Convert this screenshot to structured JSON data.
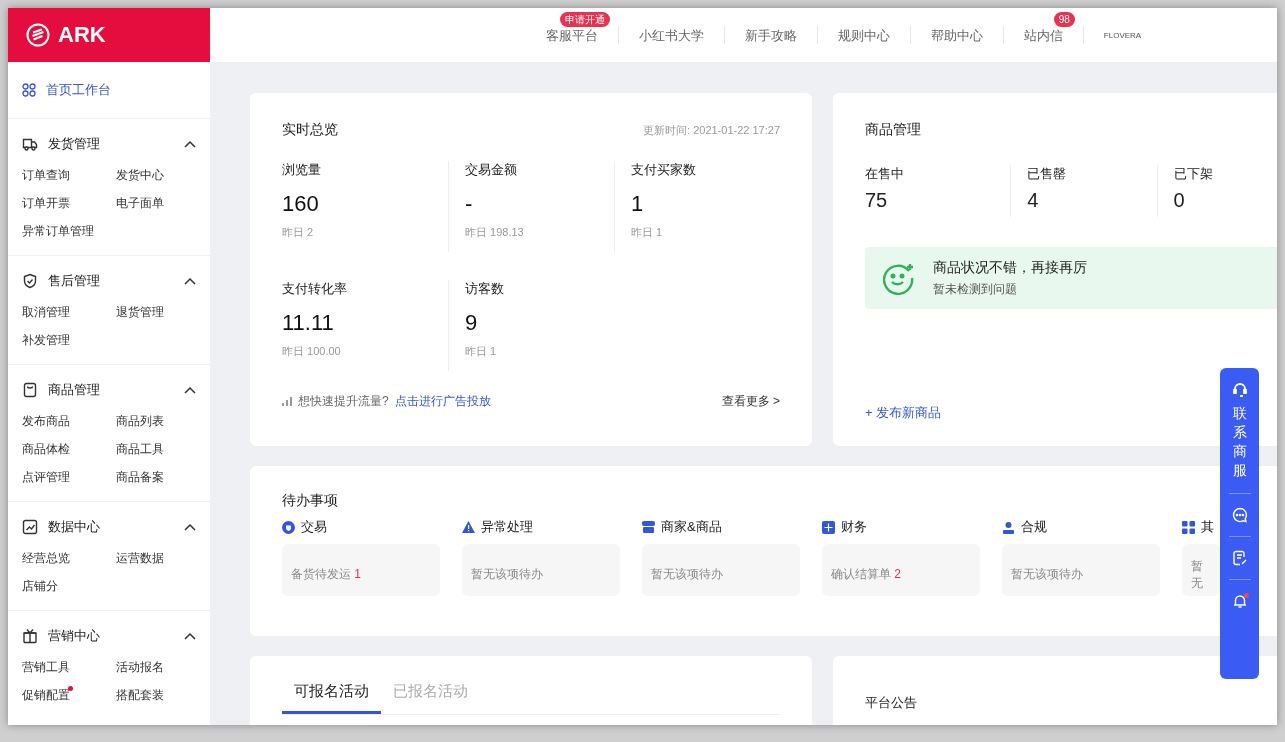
{
  "brand": {
    "name": "ARK"
  },
  "top_nav": [
    {
      "label": "客服平台",
      "badge": "申请开通"
    },
    {
      "label": "小红书大学"
    },
    {
      "label": "新手攻略"
    },
    {
      "label": "规则中心"
    },
    {
      "label": "帮助中心"
    },
    {
      "label": "站内信",
      "badge": "98"
    },
    {
      "label": "FLOVERA",
      "kind": "mini"
    }
  ],
  "sidebar": {
    "home": {
      "label": "首页工作台",
      "selected": true
    },
    "groups": [
      {
        "title": "发货管理",
        "kind": "truck",
        "expanded": true,
        "items": [
          {
            "label": "订单查询",
            "dot": false
          },
          {
            "label": "发货中心",
            "dot": false
          },
          {
            "label": "订单开票",
            "dot": false
          },
          {
            "label": "电子面单",
            "dot": false
          },
          {
            "label": "异常订单管理",
            "dot": false
          }
        ]
      },
      {
        "title": "售后管理",
        "kind": "shield",
        "expanded": true,
        "items": [
          {
            "label": "取消管理",
            "dot": false
          },
          {
            "label": "退货管理",
            "dot": false
          },
          {
            "label": "补发管理",
            "dot": false
          }
        ]
      },
      {
        "title": "商品管理",
        "kind": "bag",
        "expanded": true,
        "items": [
          {
            "label": "发布商品",
            "dot": false
          },
          {
            "label": "商品列表",
            "dot": false
          },
          {
            "label": "商品体检",
            "dot": false
          },
          {
            "label": "商品工具",
            "dot": false
          },
          {
            "label": "点评管理",
            "dot": false
          },
          {
            "label": "商品备案",
            "dot": false
          }
        ]
      },
      {
        "title": "数据中心",
        "kind": "chart",
        "expanded": true,
        "items": [
          {
            "label": "经营总览",
            "dot": false
          },
          {
            "label": "运营数据",
            "dot": false
          },
          {
            "label": "店铺分",
            "dot": false
          }
        ]
      },
      {
        "title": "营销中心",
        "kind": "gift",
        "expanded": true,
        "items": [
          {
            "label": "营销工具",
            "dot": false
          },
          {
            "label": "活动报名",
            "dot": false
          },
          {
            "label": "促销配置",
            "dot": true
          },
          {
            "label": "搭配套装",
            "dot": false
          }
        ]
      }
    ]
  },
  "overview": {
    "title": "实时总览",
    "updated": "更新时间: 2021-01-22 17:27",
    "metrics": [
      {
        "label": "浏览量",
        "value": "160",
        "yesterday": "昨日 2"
      },
      {
        "label": "交易金额",
        "value": "-",
        "yesterday": "昨日 198.13"
      },
      {
        "label": "支付买家数",
        "value": "1",
        "yesterday": "昨日 1"
      },
      {
        "label": "支付转化率",
        "value": "11.11",
        "yesterday": "昨日 100.00"
      },
      {
        "label": "访客数",
        "value": "9",
        "yesterday": "昨日 1"
      }
    ],
    "promo_text": "想快速提升流量?",
    "promo_link": "点击进行广告投放",
    "more": "查看更多 >"
  },
  "goods": {
    "title": "商品管理",
    "stats": [
      {
        "label": "在售中",
        "value": "75"
      },
      {
        "label": "已售罄",
        "value": "4"
      },
      {
        "label": "已下架",
        "value": "0"
      }
    ],
    "status": {
      "title": "商品状况不错，再接再厉",
      "subtitle": "暂未检测到问题"
    },
    "publish": "+ 发布新商品"
  },
  "todo": {
    "title": "待办事项",
    "categories": [
      {
        "name": "交易",
        "kind": "trade",
        "item": "备货待发运",
        "count": "1"
      },
      {
        "name": "异常处理",
        "kind": "warning",
        "item": "暂无该项待办"
      },
      {
        "name": "商家&商品",
        "kind": "store",
        "item": "暂无该项待办"
      },
      {
        "name": "财务",
        "kind": "finance",
        "item": "确认结算单",
        "count": "2"
      },
      {
        "name": "合规",
        "kind": "person",
        "item": "暂无该项待办"
      },
      {
        "name": "其",
        "kind": "grid",
        "item": "暂无"
      }
    ]
  },
  "activity": {
    "tabs": [
      {
        "label": "可报名活动",
        "selected": true
      },
      {
        "label": "已报名活动",
        "selected": false
      }
    ]
  },
  "notice": {
    "title": "平台公告"
  },
  "float_bar": {
    "label": "联系商服",
    "bell_dot": true
  }
}
